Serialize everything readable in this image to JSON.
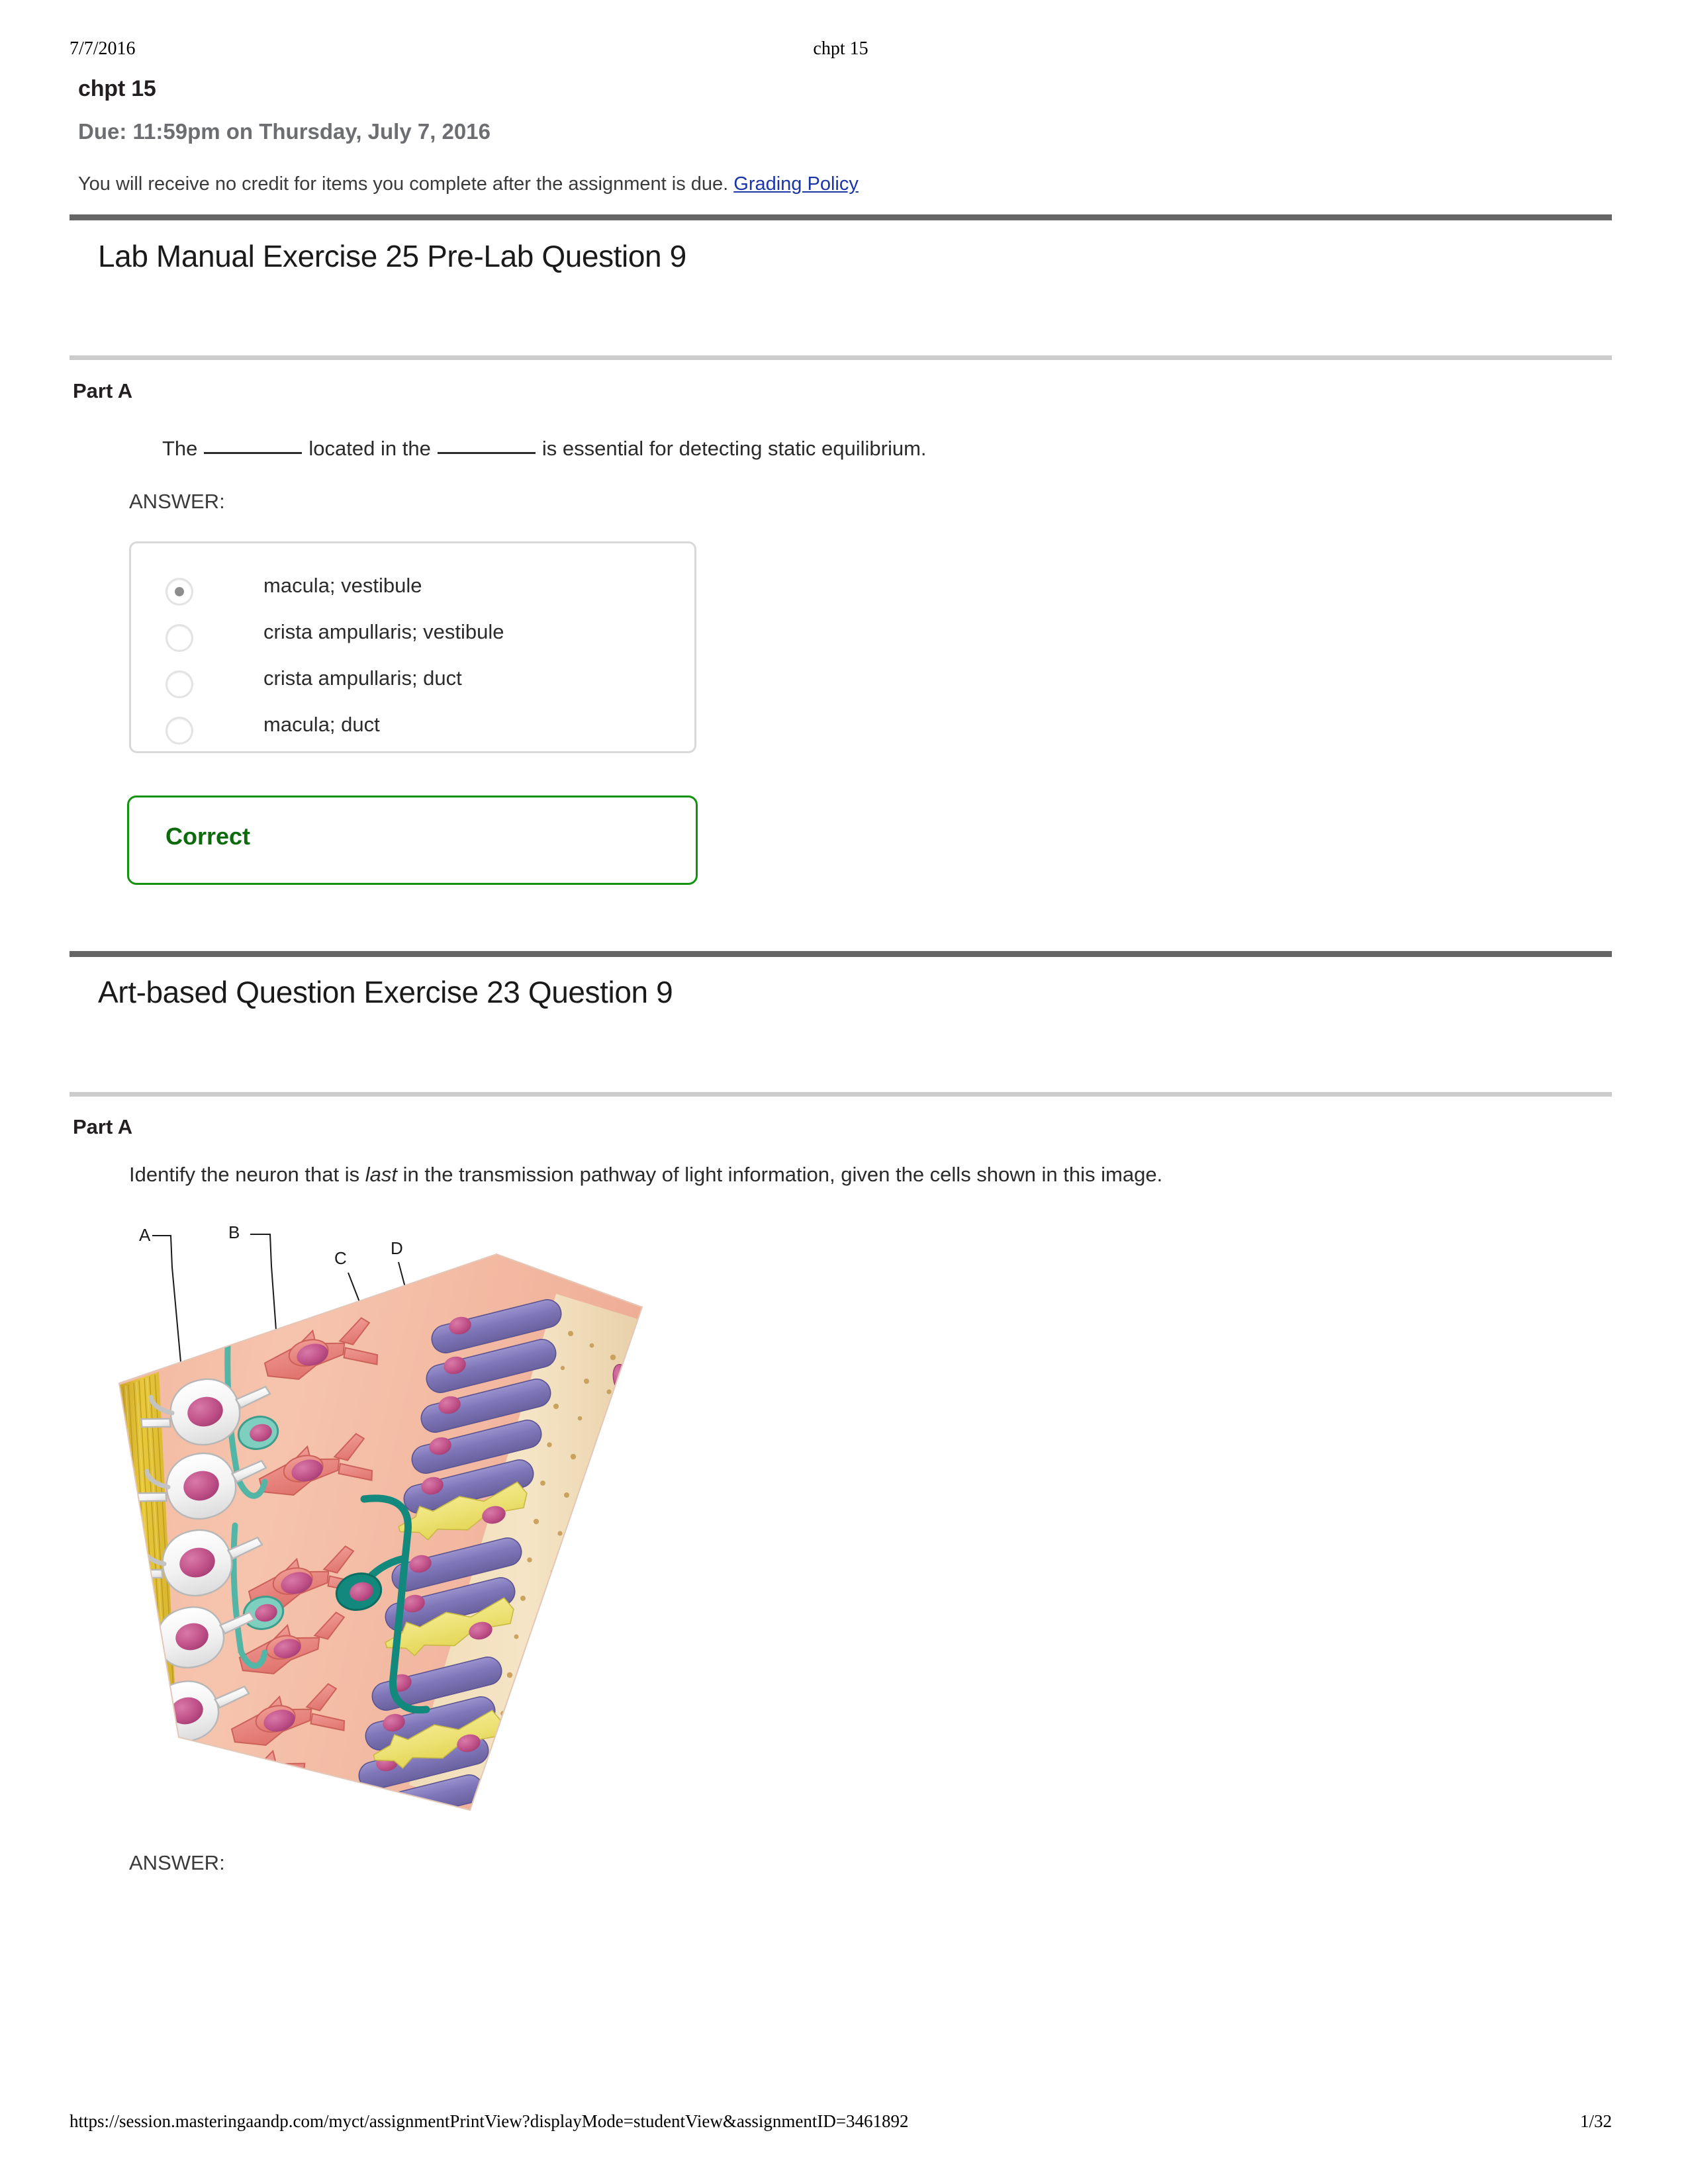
{
  "print_header": {
    "date": "7/7/2016",
    "center_title": "chpt 15"
  },
  "assignment": {
    "title": "chpt 15",
    "due": "Due: 11:59pm on Thursday, July 7, 2016",
    "note_text": "You will receive no credit for items you complete after the assignment is due.",
    "policy_link": "Grading Policy"
  },
  "sections": [
    {
      "title": "Lab Manual Exercise 25 Pre-Lab Question 9",
      "part_label": "Part A",
      "question_prefix": "The",
      "question_middle": "located in the",
      "question_suffix": "is essential for detecting static equilibrium.",
      "answer_label": "ANSWER:",
      "choices": [
        {
          "label": "macula; vestibule",
          "selected": true
        },
        {
          "label": "crista ampullaris; vestibule",
          "selected": false
        },
        {
          "label": "crista ampullaris; duct",
          "selected": false
        },
        {
          "label": "macula; duct",
          "selected": false
        }
      ],
      "feedback": "Correct"
    },
    {
      "title": "Art-based Question Exercise 23 Question 9",
      "part_label": "Part A",
      "question_pre": "Identify the neuron that is ",
      "question_em": "last",
      "question_post": " in the transmission pathway of light information, given the cells shown in this image.",
      "answer_label": "ANSWER:",
      "figure": {
        "alt": "Cross-section of the retina showing ganglion cells, bipolar cells, amacrine and horizontal cells, rods and cones, and the pigmented epithelium.",
        "leader_labels": [
          "A",
          "B",
          "C",
          "D"
        ]
      }
    }
  ],
  "print_footer": {
    "url": "https://session.masteringaandp.com/myct/assignmentPrintView?displayMode=studentView&assignmentID=3461892",
    "page": "1/32"
  },
  "colors": {
    "link": "#1b35a8",
    "rule_thick": "#666666",
    "rule_thin": "#cccccc",
    "correct_green": "#0d6b0d",
    "correct_border": "#13930f",
    "due_gray": "#6d6e71"
  }
}
